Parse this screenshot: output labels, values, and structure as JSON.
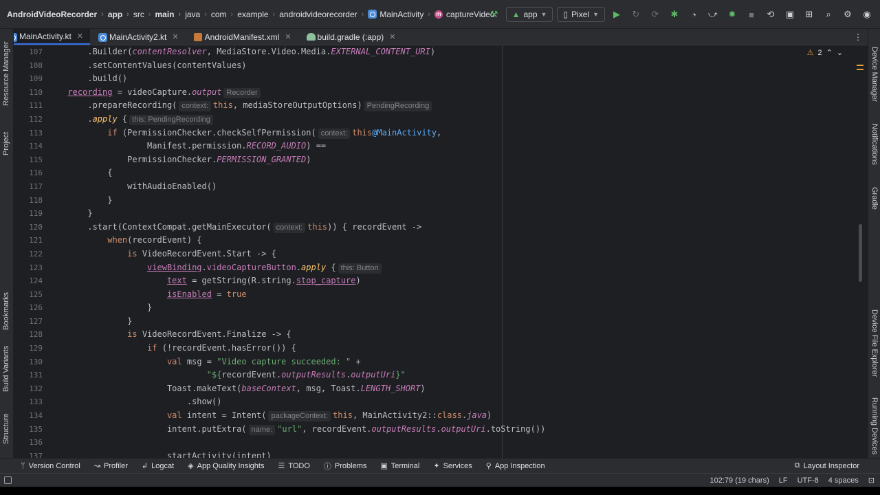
{
  "breadcrumb": [
    {
      "label": "AndroidVideoRecorder",
      "bold": true
    },
    {
      "label": "app",
      "bold": true
    },
    {
      "label": "src"
    },
    {
      "label": "main",
      "bold": true
    },
    {
      "label": "java"
    },
    {
      "label": "com"
    },
    {
      "label": "example"
    },
    {
      "label": "androidvideorecorder"
    },
    {
      "label": "MainActivity",
      "icon": "kotlin-class-icon"
    },
    {
      "label": "captureVideo",
      "icon": "method-icon"
    }
  ],
  "toolbar": {
    "run_config": "app",
    "device": "Pixel"
  },
  "tabs": [
    {
      "label": "MainActivity.kt",
      "active": true,
      "icon": "kotlin-file-icon"
    },
    {
      "label": "MainActivity2.kt",
      "icon": "kotlin-file-icon"
    },
    {
      "label": "AndroidManifest.xml",
      "icon": "xml-file-icon"
    },
    {
      "label": "build.gradle (:app)",
      "icon": "gradle-icon"
    }
  ],
  "left_tools": [
    "Resource Manager",
    "Project",
    "Bookmarks",
    "Build Variants",
    "Structure"
  ],
  "right_tools": [
    "Device Manager",
    "Notifications",
    "Gradle",
    "Device File Explorer",
    "Running Devices"
  ],
  "editor": {
    "warnings_count": "2",
    "line_numbers": [
      "107",
      "108",
      "109",
      "110",
      "111",
      "112",
      "113",
      "114",
      "115",
      "116",
      "117",
      "118",
      "119",
      "120",
      "121",
      "122",
      "123",
      "124",
      "125",
      "126",
      "127",
      "128",
      "129",
      "130",
      "131",
      "132",
      "133",
      "134",
      "135",
      "136",
      "137"
    ],
    "hints": {
      "recorder": "Recorder",
      "context": "context:",
      "pending_recording": "PendingRecording",
      "this_pending": "this: PendingRecording",
      "this_button": "this: Button",
      "package_context": "packageContext:",
      "name": "name:"
    }
  },
  "bottom_tools": [
    {
      "label": "Version Control",
      "icon": "branch-icon"
    },
    {
      "label": "Profiler",
      "icon": "profiler-icon"
    },
    {
      "label": "Logcat",
      "icon": "logcat-icon"
    },
    {
      "label": "App Quality Insights",
      "icon": "insights-icon"
    },
    {
      "label": "TODO",
      "icon": "todo-icon"
    },
    {
      "label": "Problems",
      "icon": "problems-icon"
    },
    {
      "label": "Terminal",
      "icon": "terminal-icon"
    },
    {
      "label": "Services",
      "icon": "services-icon"
    },
    {
      "label": "App Inspection",
      "icon": "inspection-icon"
    }
  ],
  "layout_inspector": "Layout Inspector",
  "status": {
    "position": "102:79 (19 chars)",
    "line_sep": "LF",
    "encoding": "UTF-8",
    "indent": "4 spaces"
  }
}
